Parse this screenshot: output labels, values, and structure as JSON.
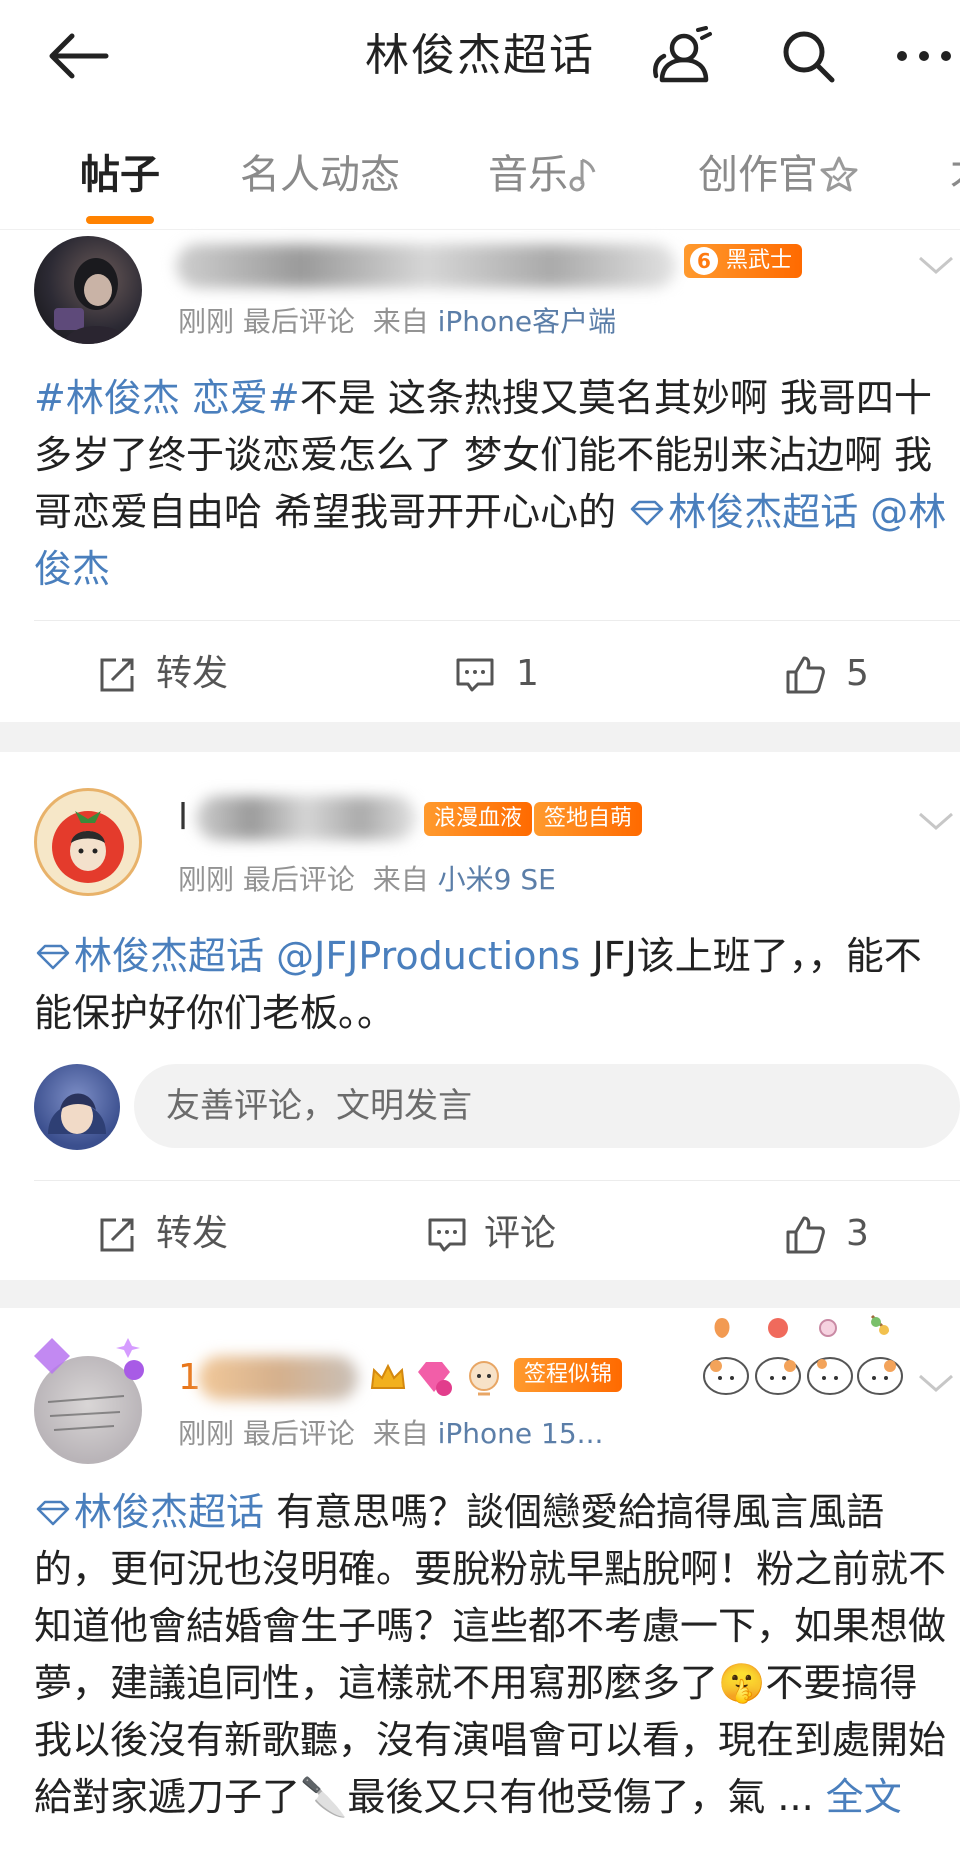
{
  "header": {
    "title": "林俊杰超话"
  },
  "tabs": [
    "帖子",
    "名人动态",
    "音乐",
    "创作官"
  ],
  "posts": [
    {
      "badge_level": "6",
      "badge": "黑武士",
      "meta_time": "刚刚 最后评论",
      "meta_from": "来自",
      "meta_source": "iPhone客户端",
      "text_hashtag": "#林俊杰 恋爱#",
      "text_body": "不是 这条热搜又莫名其妙啊 我哥四十多岁了终于谈恋爱怎么了 梦女们能不能别来沾边啊 我哥恋爱自由哈 希望我哥开开心心的",
      "text_topic": "林俊杰超话",
      "text_mention": "@林俊杰",
      "repost_label": "转发",
      "comment_count": "1",
      "like_count": "5"
    },
    {
      "badge1": "浪漫血液",
      "badge2": "签地自萌",
      "name_initial": "l",
      "meta_time": "刚刚 最后评论",
      "meta_from": "来自",
      "meta_source": "小米9 SE",
      "text_topic": "林俊杰超话",
      "text_mention": "@JFJProductions",
      "text_body": " JFJ该上班了，，能不能保护好你们老板。。",
      "comment_placeholder": "友善评论，文明发言",
      "repost_label": "转发",
      "comment_label": "评论",
      "like_count": "3"
    },
    {
      "name_initial": "1",
      "badge": "签程似锦",
      "meta_time": "刚刚 最后评论",
      "meta_from": "来自",
      "meta_source": "iPhone 15...",
      "text_topic": "林俊杰超话",
      "text_body": " 有意思嗎？談個戀愛給搞得風言風語的，更何況也沒明確。要脫粉就早點脫啊！粉之前就不知道他會結婚會生子嗎？這些都不考慮一下，如果想做夢，建議追同性，這樣就不用寫那麼多了🤫不要搞得我以後沒有新歌聽，沒有演唱會可以看，現在到處開始給對家遞刀子了🔪最後又只有他受傷了，氣",
      "ellipsis": " ... ",
      "more_label": "全文"
    }
  ]
}
